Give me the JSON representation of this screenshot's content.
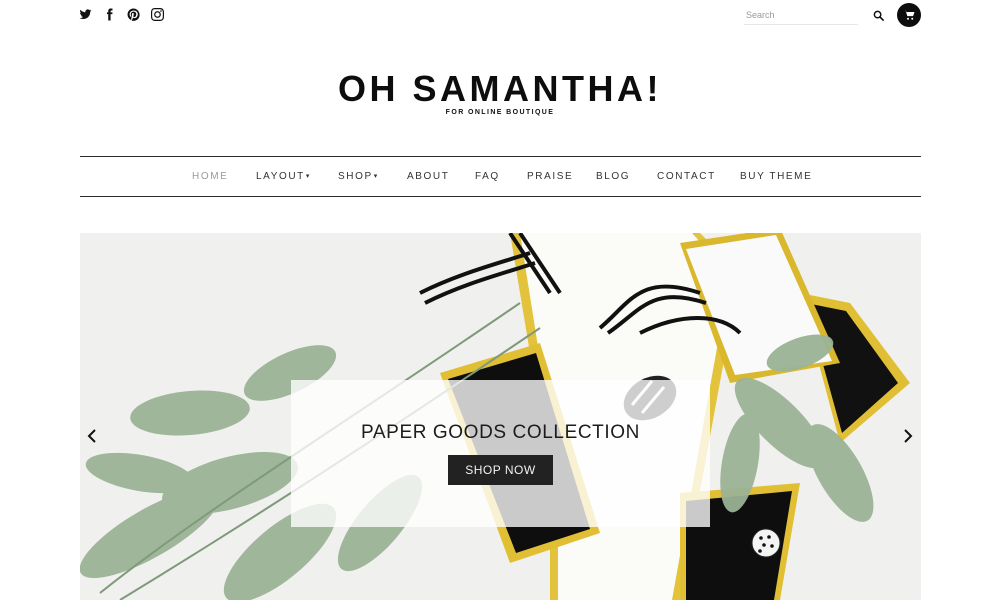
{
  "header": {
    "social": [
      {
        "icon": "twitter-icon"
      },
      {
        "icon": "facebook-icon"
      },
      {
        "icon": "pinterest-icon"
      },
      {
        "icon": "instagram-icon"
      }
    ],
    "search": {
      "placeholder": "Search",
      "value": "",
      "icon": "search-icon"
    },
    "cart": {
      "icon": "cart-icon"
    }
  },
  "brand": {
    "title": "OH SAMANTHA!",
    "tagline": "FOR ONLINE BOUTIQUE"
  },
  "nav": {
    "items": [
      {
        "label": "HOME",
        "active": true
      },
      {
        "label": "LAYOUT",
        "dropdown": true
      },
      {
        "label": "SHOP",
        "dropdown": true
      },
      {
        "label": "ABOUT"
      },
      {
        "label": "FAQ"
      },
      {
        "label": "PRAISE"
      },
      {
        "label": "BLOG"
      },
      {
        "label": "CONTACT"
      },
      {
        "label": "BUY THEME"
      }
    ],
    "caret": "▾"
  },
  "hero": {
    "caption_title": "PAPER GOODS COLLECTION",
    "button_label": "SHOP NOW",
    "prev_icon": "chevron-left-icon",
    "next_icon": "chevron-right-icon"
  },
  "colors": {
    "text": "#1a1a1a",
    "active_nav": "#9a9a9a",
    "button_bg": "#222222",
    "gold": "#e2c23a",
    "leaf": "#8fa88b"
  }
}
